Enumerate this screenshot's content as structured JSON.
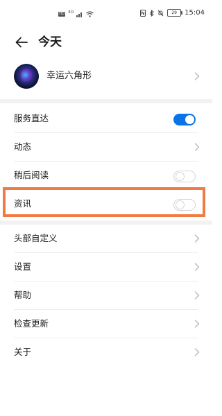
{
  "status_bar": {
    "hd_label": "HD",
    "signal_label": "4G",
    "battery": "29",
    "time": "15:04"
  },
  "header": {
    "title": "今天",
    "back_icon": "arrow-left-icon"
  },
  "account": {
    "name": "幸运六角形"
  },
  "settings": {
    "items": [
      {
        "label": "服务直达",
        "control": "toggle",
        "on": true
      },
      {
        "label": "动态",
        "control": "chevron"
      },
      {
        "label": "稍后阅读",
        "control": "toggle",
        "on": false
      },
      {
        "label": "资讯",
        "control": "toggle",
        "on": false
      }
    ],
    "items2": [
      {
        "label": "头部自定义"
      },
      {
        "label": "设置"
      },
      {
        "label": "帮助"
      },
      {
        "label": "检查更新"
      },
      {
        "label": "关于"
      }
    ]
  },
  "colors": {
    "accent": "#0a73e8",
    "highlight": "#f07c45",
    "divider": "#f2f2f2"
  }
}
